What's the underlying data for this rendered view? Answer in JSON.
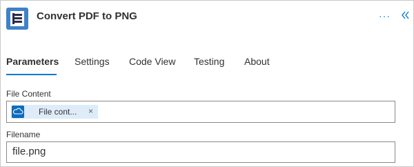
{
  "header": {
    "title": "Convert PDF to PNG",
    "more_glyph": "···",
    "collapse_icon": "chevrons-left-icon",
    "app_icon": "document-app-icon",
    "accent_color": "#0078d4"
  },
  "tabs": [
    {
      "label": "Parameters",
      "active": true
    },
    {
      "label": "Settings",
      "active": false
    },
    {
      "label": "Code View",
      "active": false
    },
    {
      "label": "Testing",
      "active": false
    },
    {
      "label": "About",
      "active": false
    }
  ],
  "fields": {
    "file_content": {
      "label": "File Content",
      "token": {
        "label": "File cont...",
        "icon": "cloud-icon",
        "remove_glyph": "×"
      }
    },
    "filename": {
      "label": "Filename",
      "value": "file.png"
    }
  }
}
